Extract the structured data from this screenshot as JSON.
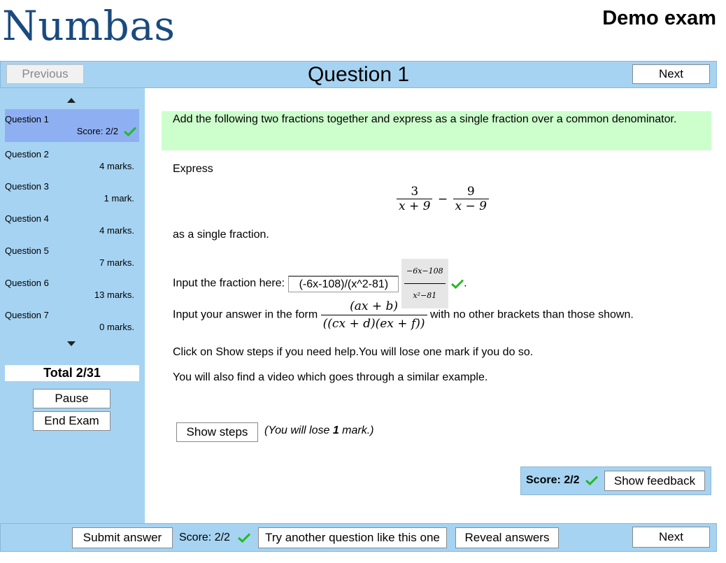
{
  "header": {
    "logo": "Numbas",
    "exam_title": "Demo exam"
  },
  "nav": {
    "previous_label": "Previous",
    "next_label": "Next",
    "question_title": "Question 1"
  },
  "sidebar": {
    "questions": [
      {
        "name": "Question 1",
        "marks": "Score: 2/2"
      },
      {
        "name": "Question 2",
        "marks": "4 marks."
      },
      {
        "name": "Question 3",
        "marks": "1 mark."
      },
      {
        "name": "Question 4",
        "marks": "4 marks."
      },
      {
        "name": "Question 5",
        "marks": "7 marks."
      },
      {
        "name": "Question 6",
        "marks": "13 marks."
      },
      {
        "name": "Question 7",
        "marks": "0 marks."
      }
    ],
    "total": "Total 2/31",
    "pause_label": "Pause",
    "end_exam_label": "End Exam"
  },
  "question": {
    "statement": "Add the following two fractions together and express as a single fraction over a common denominator.",
    "express": "Express",
    "math_num1": "3",
    "math_den1": "x + 9",
    "math_minus": "−",
    "math_num2": "9",
    "math_den2": "x − 9",
    "single_fraction": "as a single fraction.",
    "input_prompt": "Input the fraction here:",
    "input_value": "(-6x-108)/(x^2-81)",
    "preview_num": "−6x−108",
    "preview_den": "x²−81",
    "period": ".",
    "form_prompt": "Input your answer in the form",
    "form_num": "(ax + b)",
    "form_den": "((cx + d)(ex + f))",
    "form_suffix": "with no other brackets than those shown.",
    "steps_hint": "Click on Show steps if you need help.You will lose one mark if you do so.",
    "video_hint": "You will also find a video which goes through a similar example.",
    "show_steps_label": "Show steps",
    "lose_prefix": "(You will lose ",
    "lose_count": "1",
    "lose_suffix": " mark.)",
    "score_label": "Score: 2/2",
    "show_feedback_label": "Show feedback"
  },
  "bottom": {
    "submit_label": "Submit answer",
    "score_label": "Score: 2/2",
    "try_another_label": "Try another question like this one",
    "reveal_label": "Reveal answers",
    "next_label": "Next"
  },
  "colors": {
    "panel": "#a6d3f2",
    "current_question": "#8eb0f3",
    "statement_bg": "#ccffcc",
    "logo": "#1a4a7e",
    "tick": "#22bb22"
  }
}
